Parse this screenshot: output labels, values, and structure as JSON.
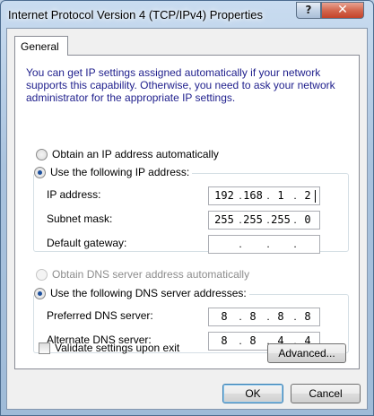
{
  "window": {
    "title": "Internet Protocol Version 4 (TCP/IPv4) Properties",
    "help_glyph": "?",
    "close_glyph": "✕"
  },
  "tabs": [
    {
      "label": "General",
      "selected": true
    }
  ],
  "description": "You can get IP settings assigned automatically if your network supports this capability. Otherwise, you need to ask your network administrator for the appropriate IP settings.",
  "ip_mode": {
    "auto_label": "Obtain an IP address automatically",
    "manual_label": "Use the following IP address:",
    "selected": "manual"
  },
  "ip_fields": [
    {
      "label": "IP address:",
      "octets": [
        "192",
        "168",
        "1",
        "2"
      ],
      "focused": true
    },
    {
      "label": "Subnet mask:",
      "octets": [
        "255",
        "255",
        "255",
        "0"
      ]
    },
    {
      "label": "Default gateway:",
      "octets": [
        "",
        "",
        "",
        ""
      ]
    }
  ],
  "dns_mode": {
    "auto_label": "Obtain DNS server address automatically",
    "auto_enabled": false,
    "manual_label": "Use the following DNS server addresses:",
    "selected": "manual"
  },
  "dns_fields": [
    {
      "label": "Preferred DNS server:",
      "octets": [
        "8",
        "8",
        "8",
        "8"
      ]
    },
    {
      "label": "Alternate DNS server:",
      "octets": [
        "8",
        "8",
        "4",
        "4"
      ]
    }
  ],
  "validate": {
    "label": "Validate settings upon exit",
    "checked": false
  },
  "buttons": {
    "advanced": "Advanced...",
    "ok": "OK",
    "cancel": "Cancel"
  },
  "colors": {
    "description_text": "#1e1e8c",
    "radio_dot": "#1c4f9c",
    "disabled_text": "#8d8d8d"
  }
}
